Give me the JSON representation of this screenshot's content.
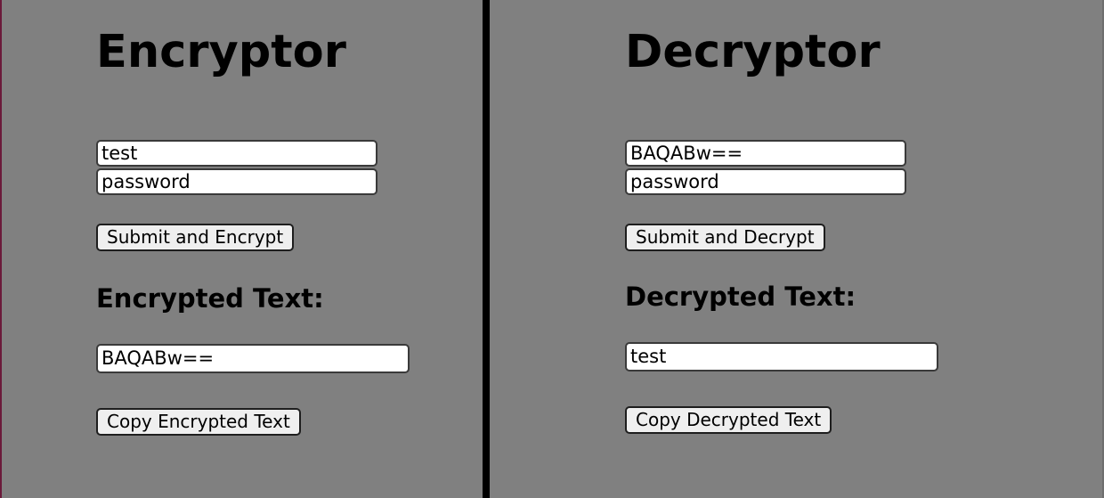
{
  "encryptor": {
    "title": "Encryptor",
    "message_value": "test",
    "password_value": "password",
    "submit_label": "Submit and Encrypt",
    "result_heading": "Encrypted Text:",
    "result_value": "BAQABw==",
    "copy_label": "Copy Encrypted Text"
  },
  "decryptor": {
    "title": "Decryptor",
    "message_value": "BAQABw==",
    "password_value": "password",
    "submit_label": "Submit and Decrypt",
    "result_heading": "Decrypted Text:",
    "result_value": "test",
    "copy_label": "Copy Decrypted Text"
  },
  "colors": {
    "background": "#808080",
    "divider": "#000000",
    "input_background": "#ffffff",
    "button_background": "#efefef"
  }
}
